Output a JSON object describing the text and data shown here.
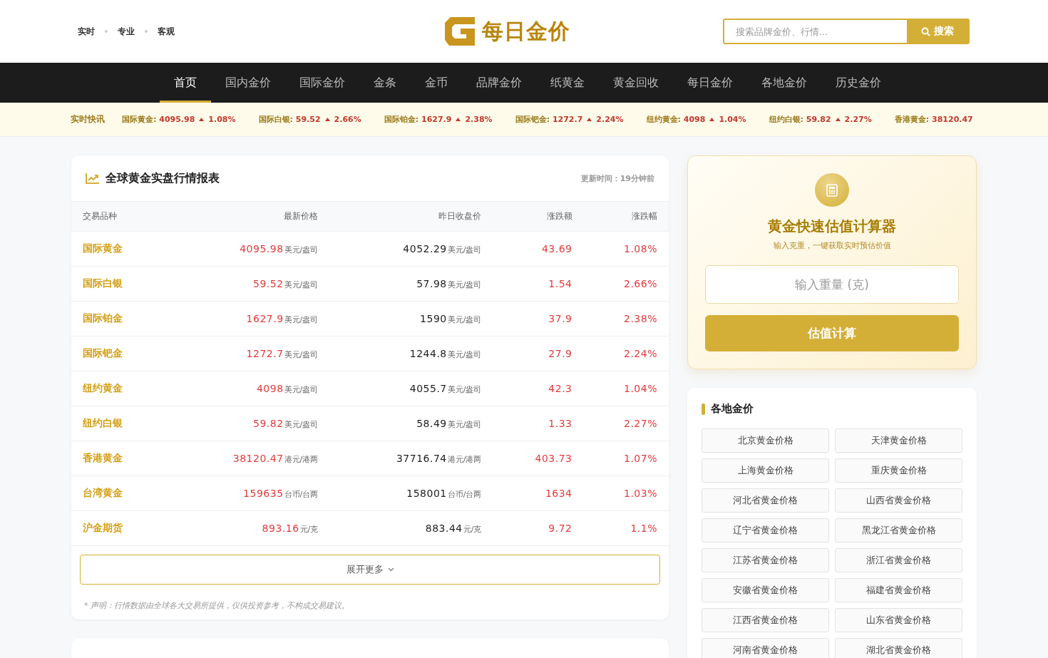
{
  "header": {
    "tags": [
      "实时",
      "专业",
      "客观"
    ],
    "logo": "每日金价",
    "search": {
      "placeholder": "搜索品牌金价、行情...",
      "button": "搜索"
    }
  },
  "nav": [
    {
      "label": "首页",
      "selected": true
    },
    {
      "label": "国内金价",
      "selected": false
    },
    {
      "label": "国际金价",
      "selected": false
    },
    {
      "label": "金条",
      "selected": false
    },
    {
      "label": "金币",
      "selected": false
    },
    {
      "label": "品牌金价",
      "selected": false
    },
    {
      "label": "纸黄金",
      "selected": false
    },
    {
      "label": "黄金回收",
      "selected": false
    },
    {
      "label": "每日金价",
      "selected": false
    },
    {
      "label": "各地金价",
      "selected": false
    },
    {
      "label": "历史金价",
      "selected": false
    }
  ],
  "ticker": {
    "label": "实时快讯",
    "items": [
      {
        "name": "国际黄金:",
        "value": "4095.98",
        "pct": "1.08%"
      },
      {
        "name": "国际白银:",
        "value": "59.52",
        "pct": "2.66%"
      },
      {
        "name": "国际铂金:",
        "value": "1627.9",
        "pct": "2.38%"
      },
      {
        "name": "国际钯金:",
        "value": "1272.7",
        "pct": "2.24%"
      },
      {
        "name": "纽约黄金:",
        "value": "4098",
        "pct": "1.04%"
      },
      {
        "name": "纽约白银:",
        "value": "59.82",
        "pct": "2.27%"
      },
      {
        "name": "香港黄金:",
        "value": "38120.47"
      }
    ]
  },
  "market": {
    "title": "全球黄金实盘行情报表",
    "updated": "更新时间：19分钟前",
    "columns": [
      "交易品种",
      "最新价格",
      "昨日收盘价",
      "涨跌额",
      "涨跌幅"
    ],
    "rows": [
      {
        "name": "国际黄金",
        "price": "4095.98",
        "unit": "美元/盎司",
        "prev": "4052.29",
        "prev_unit": "美元/盎司",
        "change": "43.69",
        "pct": "1.08%"
      },
      {
        "name": "国际白银",
        "price": "59.52",
        "unit": "美元/盎司",
        "prev": "57.98",
        "prev_unit": "美元/盎司",
        "change": "1.54",
        "pct": "2.66%"
      },
      {
        "name": "国际铂金",
        "price": "1627.9",
        "unit": "美元/盎司",
        "prev": "1590",
        "prev_unit": "美元/盎司",
        "change": "37.9",
        "pct": "2.38%"
      },
      {
        "name": "国际钯金",
        "price": "1272.7",
        "unit": "美元/盎司",
        "prev": "1244.8",
        "prev_unit": "美元/盎司",
        "change": "27.9",
        "pct": "2.24%"
      },
      {
        "name": "纽约黄金",
        "price": "4098",
        "unit": "美元/盎司",
        "prev": "4055.7",
        "prev_unit": "美元/盎司",
        "change": "42.3",
        "pct": "1.04%"
      },
      {
        "name": "纽约白银",
        "price": "59.82",
        "unit": "美元/盎司",
        "prev": "58.49",
        "prev_unit": "美元/盎司",
        "change": "1.33",
        "pct": "2.27%"
      },
      {
        "name": "香港黄金",
        "price": "38120.47",
        "unit": "港元/港两",
        "prev": "37716.74",
        "prev_unit": "港元/港两",
        "change": "403.73",
        "pct": "1.07%"
      },
      {
        "name": "台湾黄金",
        "price": "159635",
        "unit": "台币/台两",
        "prev": "158001",
        "prev_unit": "台币/台两",
        "change": "1634",
        "pct": "1.03%"
      },
      {
        "name": "沪金期货",
        "price": "893.16",
        "unit": "元/克",
        "prev": "883.44",
        "prev_unit": "元/克",
        "change": "9.72",
        "pct": "1.1%"
      }
    ],
    "more": "展开更多",
    "disclaimer": "* 声明：行情数据由全球各大交易所提供，仅供投资参考，不构成交易建议。"
  },
  "calculator": {
    "title": "黄金快速估值计算器",
    "subtitle": "输入克重，一键获取实时预估价值",
    "placeholder": "输入重量 (克)",
    "button": "估值计算"
  },
  "regions": {
    "title": "各地金价",
    "items": [
      "北京黄金价格",
      "天津黄金价格",
      "上海黄金价格",
      "重庆黄金价格",
      "河北省黄金价格",
      "山西省黄金价格",
      "辽宁省黄金价格",
      "黑龙江省黄金价格",
      "江苏省黄金价格",
      "浙江省黄金价格",
      "安徽省黄金价格",
      "福建省黄金价格",
      "江西省黄金价格",
      "山东省黄金价格",
      "河南省黄金价格",
      "湖北省黄金价格"
    ]
  }
}
